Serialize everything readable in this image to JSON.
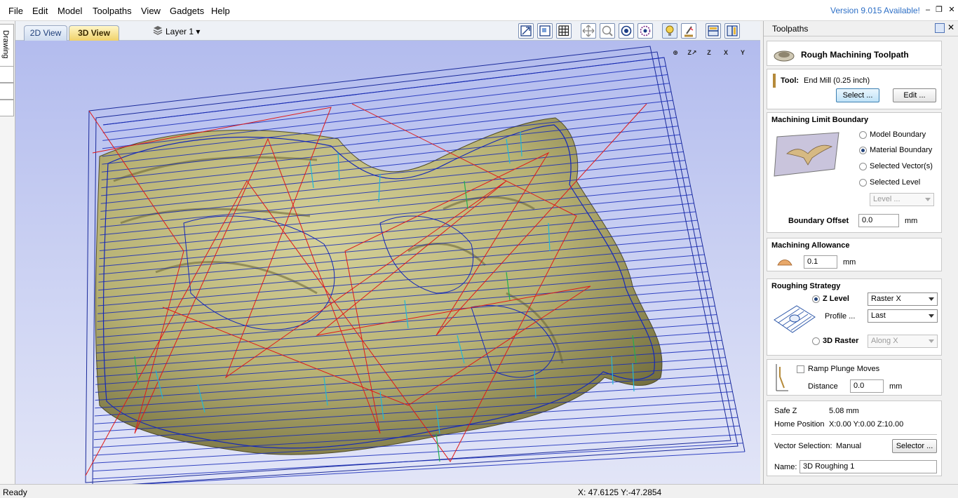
{
  "menu": [
    "File",
    "Edit",
    "Model",
    "Toolpaths",
    "View",
    "Gadgets",
    "Help"
  ],
  "version_notice": "Version 9.015 Available!",
  "window_controls": {
    "minimize": "‒",
    "restore": "❐",
    "close": "✕"
  },
  "left_strip": {
    "drawing_tab": "Drawing"
  },
  "view_tabs": {
    "tab_2d": "2D View",
    "tab_3d": "3D View",
    "active": "3D View"
  },
  "layer": {
    "label": "Layer 1",
    "caret": "▾"
  },
  "viewport_axes": {
    "zoom": "⊕",
    "iso": "Z↗",
    "top_z": "Z",
    "view_x": "X",
    "view_y": "Y"
  },
  "panel": {
    "header": "Toolpaths",
    "close_glyph": "✕",
    "toolpath_title": "Rough Machining Toolpath",
    "tool": {
      "label": "Tool:",
      "value": "End Mill (0.25 inch)",
      "select_label": "Select ...",
      "edit_label": "Edit ..."
    },
    "boundary": {
      "title": "Machining Limit Boundary",
      "options": [
        "Model Boundary",
        "Material Boundary",
        "Selected Vector(s)",
        "Selected Level"
      ],
      "selected": "Material Boundary",
      "level_dropdown": "Level ...",
      "offset_label": "Boundary Offset",
      "offset_value": "0.0",
      "offset_unit": "mm"
    },
    "allowance": {
      "title": "Machining Allowance",
      "value": "0.1",
      "unit": "mm"
    },
    "strategy": {
      "title": "Roughing Strategy",
      "z_level_label": "Z Level",
      "z_level_selected": true,
      "z_level_dropdown": "Raster X",
      "profile_label": "Profile ...",
      "profile_dropdown": "Last",
      "raster_3d_label": "3D Raster",
      "raster_3d_selected": false,
      "raster_3d_dropdown": "Along X"
    },
    "ramp": {
      "checkbox_label": "Ramp Plunge Moves",
      "checked": false,
      "distance_label": "Distance",
      "distance_value": "0.0",
      "distance_unit": "mm"
    },
    "info": {
      "safe_z_label": "Safe Z",
      "safe_z_value": "5.08 mm",
      "home_label": "Home Position",
      "home_value": "X:0.00 Y:0.00 Z:10.00",
      "vector_selection_label": "Vector Selection:",
      "vector_selection_value": "Manual",
      "selector_label": "Selector ...",
      "name_label": "Name:",
      "name_value": "3D Roughing 1"
    }
  },
  "status": {
    "text": "Ready",
    "coordinates": "X: 47.6125 Y:-47.2854"
  }
}
